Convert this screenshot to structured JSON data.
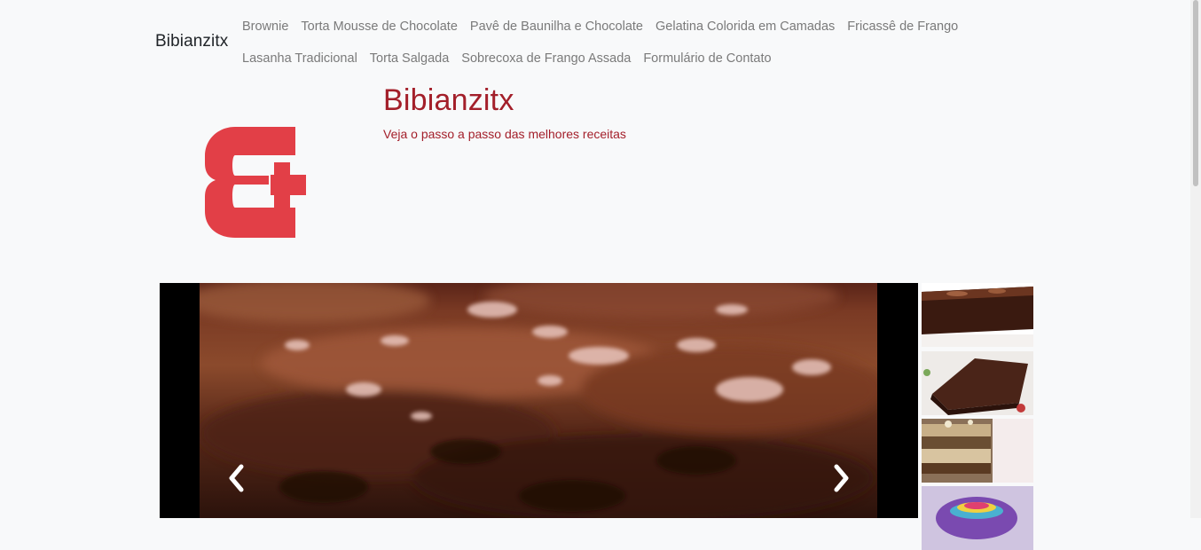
{
  "navbar": {
    "brand": "Bibianzitx",
    "row1": [
      "Brownie",
      "Torta Mousse de Chocolate",
      "Pavê de Baunilha e Chocolate",
      "Gelatina Colorida em Camadas",
      "Fricassê de Frango"
    ],
    "row2": [
      "Lasanha Tradicional",
      "Torta Salgada",
      "Sobrecoxa de Frango Assada",
      "Formulário de Contato"
    ]
  },
  "header": {
    "title": "Bibianzitx",
    "tagline": "Veja o passo a passo das melhores receitas"
  },
  "colors": {
    "accent": "#a31f2a",
    "logo": "#e23f47",
    "background": "#f8f9fa"
  },
  "carousel": {
    "active_slide": "brownie",
    "prev_icon": "chevron-left-icon",
    "next_icon": "chevron-right-icon"
  },
  "thumbnails": [
    "brownie",
    "torta-mousse-de-chocolate",
    "pave-de-baunilha-e-chocolate",
    "gelatina-colorida-em-camadas"
  ]
}
